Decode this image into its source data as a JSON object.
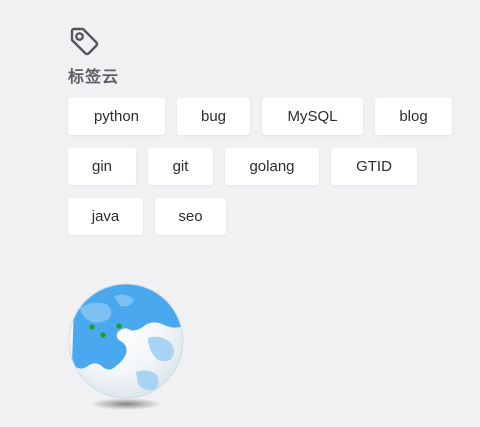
{
  "tag_cloud": {
    "icon": "tag-icon",
    "title": "标签云",
    "rows": [
      [
        {
          "label": "python"
        },
        {
          "label": "bug"
        },
        {
          "label": "MySQL"
        },
        {
          "label": "blog"
        }
      ],
      [
        {
          "label": "gin"
        },
        {
          "label": "git"
        },
        {
          "label": "golang"
        },
        {
          "label": "GTID"
        }
      ],
      [
        {
          "label": "java"
        },
        {
          "label": "seo"
        }
      ]
    ]
  },
  "globe": {
    "icon": "globe-icon",
    "marker_color": "#1aa31a",
    "ocean_color": "#4aa8ee"
  }
}
